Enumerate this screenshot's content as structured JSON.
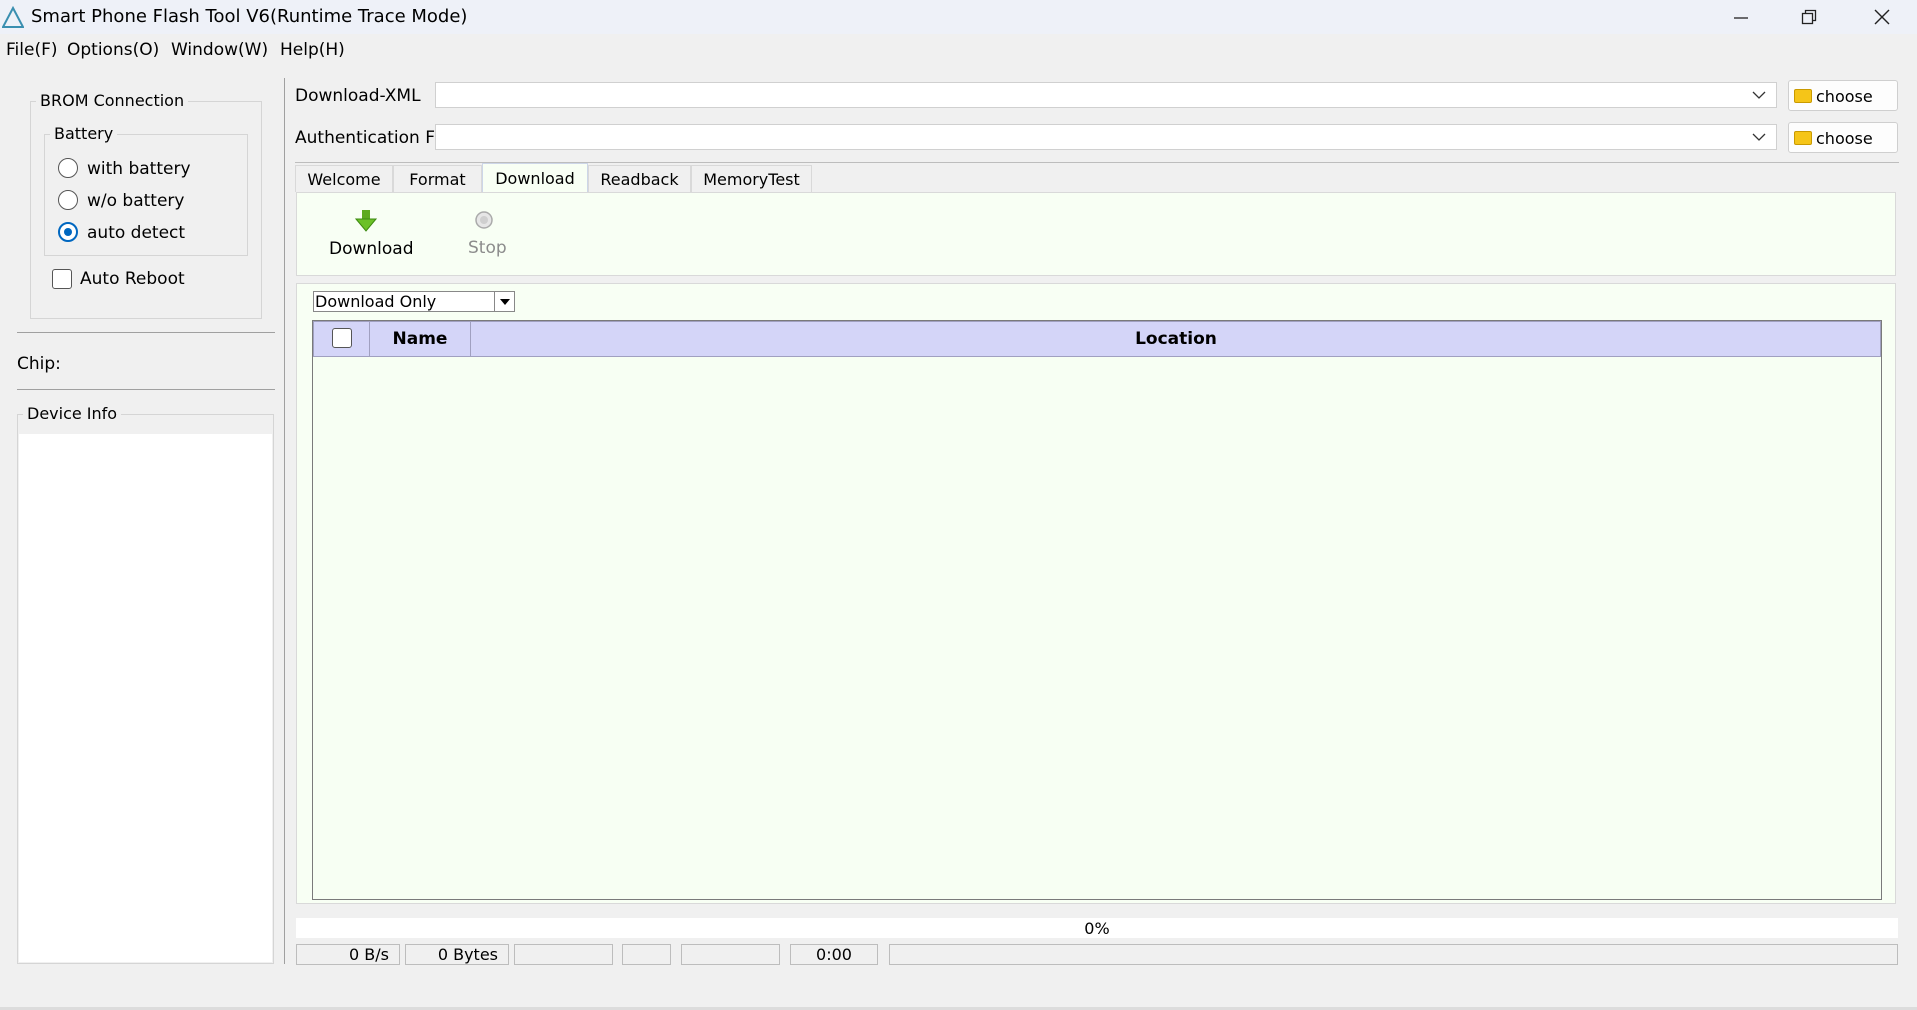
{
  "window": {
    "title": "Smart Phone Flash Tool V6(Runtime Trace Mode)"
  },
  "menu": [
    "File(F)",
    "Options(O)",
    "Window(W)",
    "Help(H)"
  ],
  "sidebar": {
    "brom_title": "BROM Connection",
    "battery_title": "Battery",
    "battery_options": [
      {
        "label": "with battery",
        "checked": false
      },
      {
        "label": "w/o battery",
        "checked": false
      },
      {
        "label": "auto detect",
        "checked": true
      }
    ],
    "auto_reboot_label": "Auto Reboot",
    "chip_label": "Chip:",
    "device_info_title": "Device Info"
  },
  "files": {
    "download_xml_label": "Download-XML",
    "download_xml_value": "",
    "auth_file_label": "Authentication File",
    "auth_file_value": "",
    "choose_label": "choose"
  },
  "tabs": [
    {
      "label": "Welcome",
      "active": false
    },
    {
      "label": "Format",
      "active": false
    },
    {
      "label": "Download",
      "active": true
    },
    {
      "label": "Readback",
      "active": false
    },
    {
      "label": "MemoryTest",
      "active": false
    }
  ],
  "toolbar": {
    "download_label": "Download",
    "stop_label": "Stop"
  },
  "download_mode": {
    "selected": "Download Only"
  },
  "table": {
    "columns": [
      "Name",
      "Location"
    ],
    "rows": []
  },
  "progress": {
    "percent_text": "0%",
    "value": 0
  },
  "status": {
    "speed": "0 B/s",
    "bytes": "0 Bytes",
    "time": "0:00"
  },
  "colors": {
    "accent": "#0067c0",
    "panel_green": "#f8fff4",
    "table_header": "#d4d5f8"
  }
}
